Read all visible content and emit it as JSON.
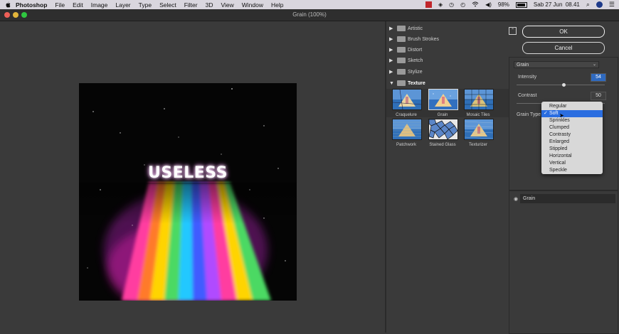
{
  "menubar": {
    "app_name": "Photoshop",
    "menus": [
      "File",
      "Edit",
      "Image",
      "Layer",
      "Type",
      "Select",
      "Filter",
      "3D",
      "View",
      "Window",
      "Help"
    ],
    "battery": "98%",
    "datetime": "Sab 27 Jun  08.41"
  },
  "window": {
    "title": "Grain (100%)"
  },
  "canvas": {
    "artwork_text": "USELESS"
  },
  "gallery": {
    "folders": [
      "Artistic",
      "Brush Strokes",
      "Distort",
      "Sketch",
      "Stylize",
      "Texture"
    ],
    "open_folder": "Texture",
    "filters": [
      "Craquelure",
      "Grain",
      "Mosaic Tiles",
      "Patchwork",
      "Stained Glass",
      "Texturizer"
    ],
    "selected_filter": "Grain"
  },
  "panel": {
    "ok_label": "OK",
    "cancel_label": "Cancel",
    "filter_select": "Grain",
    "intensity_label": "Intensity",
    "intensity_value": "54",
    "contrast_label": "Contrast",
    "contrast_value": "50",
    "grain_type_label": "Grain Type",
    "grain_types": [
      "Regular",
      "Soft",
      "Sprinkles",
      "Clumped",
      "Contrasty",
      "Enlarged",
      "Stippled",
      "Horizontal",
      "Vertical",
      "Speckle"
    ],
    "selected_grain_type": "Soft",
    "intensity_fraction": 0.54,
    "contrast_fraction": 0.5
  },
  "layers": {
    "effect_layer": "Grain"
  },
  "colors": {
    "menubar_bg": "#d9d6de",
    "panel_bg": "#3a3a3a",
    "selection_blue": "#2a6de0"
  }
}
